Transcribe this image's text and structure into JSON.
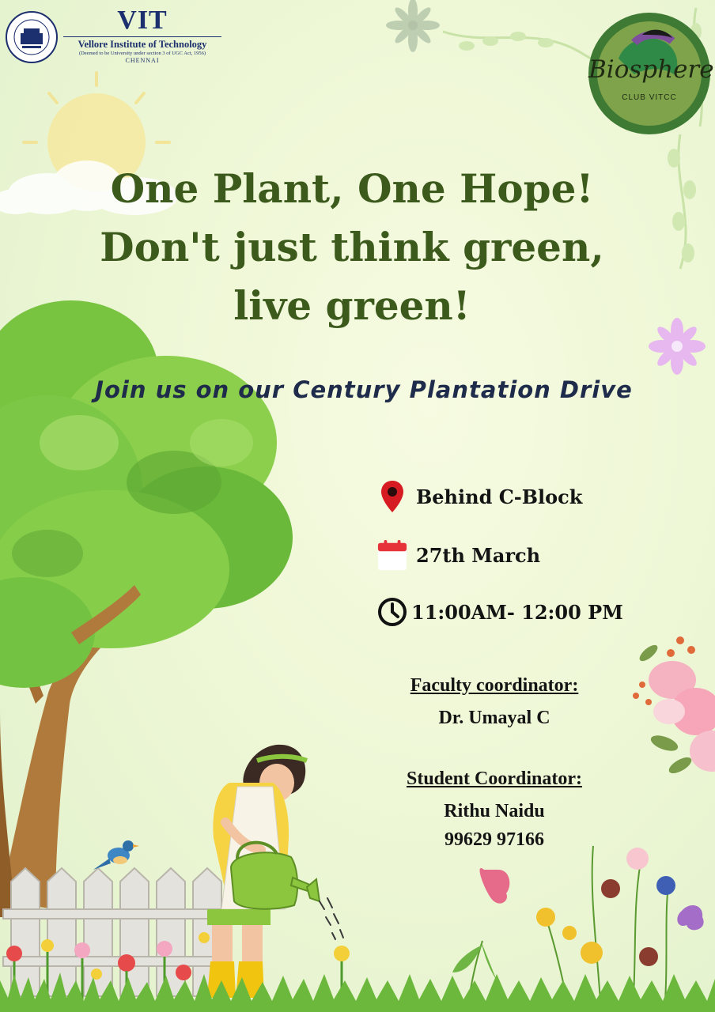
{
  "header": {
    "institution_short": "VIT",
    "institution_full": "Vellore Institute of Technology",
    "institution_note": "(Deemed to be University under section 3 of UGC Act, 1956)",
    "institution_city": "CHENNAI",
    "seal_text": "VELLORE INSTITUTE OF TECHNOLOGY",
    "club_name": "Biosphere",
    "club_sub": "CLUB VITCC"
  },
  "headline": {
    "line1": "One Plant, One Hope!",
    "line2": "Don't just think green,",
    "line3": "live green!"
  },
  "subheadline": "Join us on our Century Plantation Drive",
  "details": {
    "location": "Behind C-Block",
    "date": "27th March",
    "time": "11:00AM- 12:00 PM"
  },
  "coordinators": {
    "faculty_label": "Faculty coordinator:",
    "faculty_name": "Dr. Umayal C",
    "student_label": "Student Coordinator:",
    "student_name": "Rithu Naidu",
    "student_phone": "99629 97166"
  },
  "icons": [
    "location-pin-icon",
    "calendar-icon",
    "clock-icon"
  ],
  "colors": {
    "headline": "#3c5a1c",
    "subheadline": "#1e2b4a",
    "vit_blue": "#1c2f6e",
    "club_ring": "#3f7a35",
    "pin_red": "#d61c22",
    "background": "#eef7d6"
  }
}
